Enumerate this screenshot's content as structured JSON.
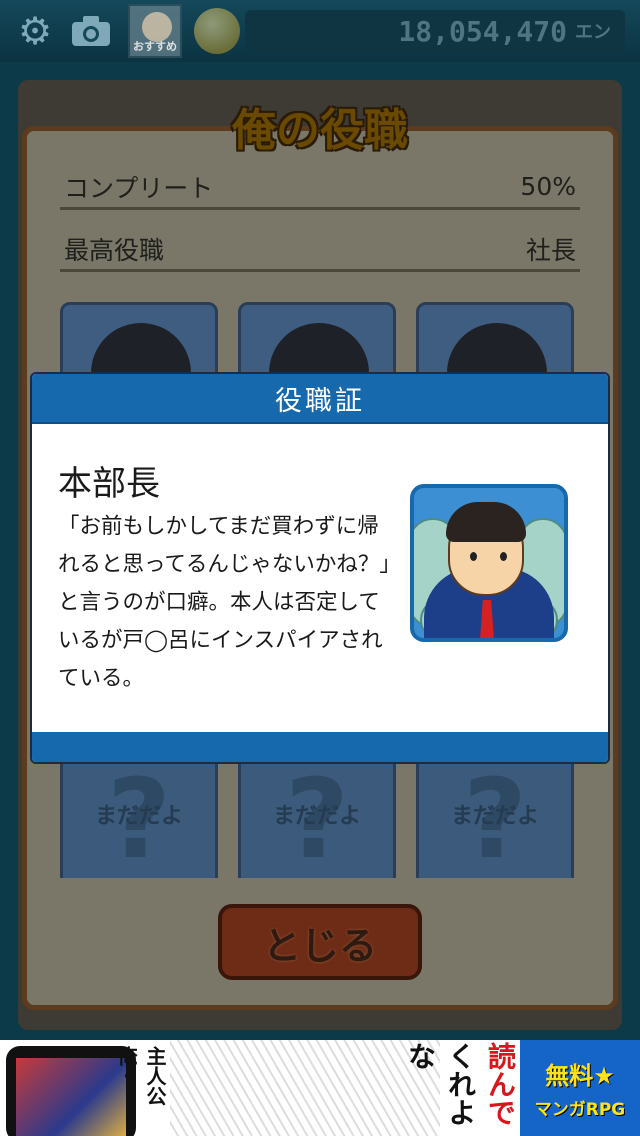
{
  "topbar": {
    "settings_icon": "gear-icon",
    "camera_icon": "camera-icon",
    "recommend_label": "おすすめ",
    "coins_icon": "coin-stack-icon",
    "money_value": "18,054,470",
    "money_unit": "エン"
  },
  "panel": {
    "title": "俺の役職",
    "complete_label": "コンプリート",
    "complete_value": "50%",
    "highest_label": "最高役職",
    "highest_value": "社長",
    "locked_text": "まだだよ",
    "locked_mark": "?",
    "close_label": "とじる"
  },
  "modal": {
    "header": "役職証",
    "name": "本部長",
    "description": "「お前もしかしてまだ買わずに帰れると思ってるんじゃないかね？」と言うのが口癖。本人は否定しているが戸◯呂にインスパイアされている。"
  },
  "ad": {
    "vertical_text": "主人公俺・",
    "read_text": "読んで",
    "read_text2": "くれよな",
    "promo_line1": "無料★",
    "promo_line2": "マンガRPG"
  },
  "colors": {
    "modal_blue": "#1769ae",
    "panel_border": "#5c3b1e",
    "close_button": "#6e2b16"
  }
}
